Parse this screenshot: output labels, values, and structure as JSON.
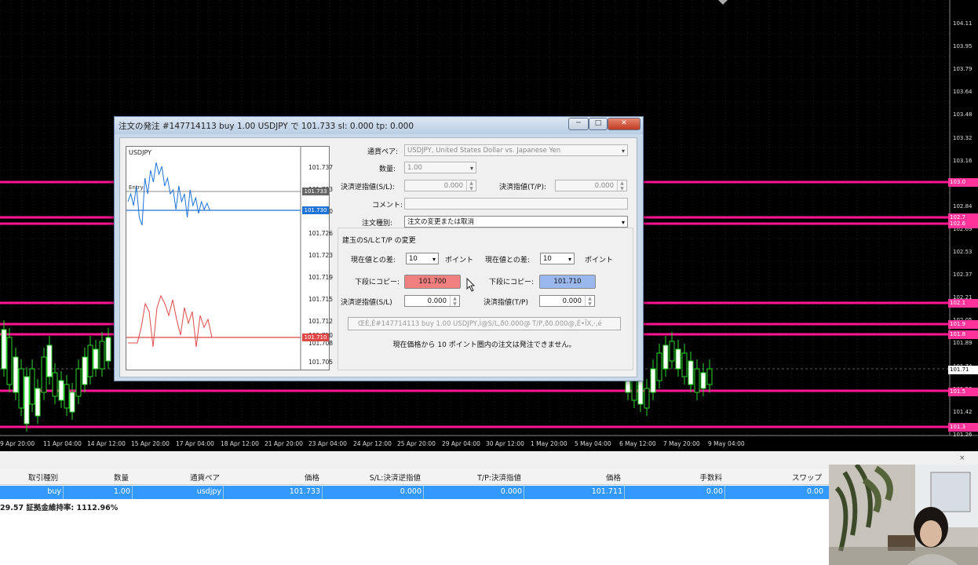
{
  "chart": {
    "price_axis": [
      "104.11",
      "103.95",
      "103.79",
      "103.64",
      "103.48",
      "103.32",
      "103.16",
      "103.00",
      "102.84",
      "102.69",
      "102.53",
      "102.37",
      "102.21",
      "102.05",
      "101.89",
      "101.74",
      "101.58",
      "101.42",
      "101.26"
    ],
    "date_axis": [
      "9 Apr 20:00",
      "11 Apr 04:00",
      "14 Apr 12:00",
      "15 Apr 20:00",
      "17 Apr 04:00",
      "18 Apr 12:00",
      "21 Apr 20:00",
      "23 Apr 04:00",
      "24 Apr 12:00",
      "25 Apr 20:00",
      "29 Apr 04:00",
      "30 Apr 12:00",
      "1 May 20:00",
      "5 May 04:00",
      "6 May 12:00",
      "7 May 20:00",
      "9 May 04:00"
    ],
    "price_tags": [
      {
        "label": "103.0",
        "color": "#ff3399"
      },
      {
        "label": "102.7",
        "color": "#ff3399"
      },
      {
        "label": "102.6",
        "color": "#ff3399"
      },
      {
        "label": "102.1",
        "color": "#ff3399"
      },
      {
        "label": "101.9",
        "color": "#ff3399"
      },
      {
        "label": "101.8",
        "color": "#ff3399"
      },
      {
        "label": "101.71",
        "color": "#ffffff"
      },
      {
        "label": "101.5",
        "color": "#ff3399"
      },
      {
        "label": "101.3",
        "color": "#ff3399"
      }
    ],
    "line_color": "#ff1493"
  },
  "dialog": {
    "title": "注文の発注 #147714113 buy 1.00 USDJPY で 101.733 sl: 0.000 tp: 0.000",
    "mini_chart": {
      "symbol": "USDJPY",
      "entry_label": "Entry",
      "ticks": [
        "101.737",
        "101.733",
        "101.730",
        "101.726",
        "101.723",
        "101.719",
        "101.715",
        "101.712",
        "101.710",
        "101.708",
        "101.705"
      ],
      "ask_tag": "101.733",
      "blue_tag": "101.730",
      "red_tag": "101.710"
    },
    "form": {
      "symbol_label": "通貨ペア:",
      "symbol_value": "USDJPY, United States Dollar vs. Japanese Yen",
      "volume_label": "数量:",
      "volume_value": "1.00",
      "sl_label": "決済逆指値(S/L):",
      "sl_value": "0.000",
      "tp_label": "決済指値(T/P):",
      "tp_value": "0.000",
      "comment_label": "コメント:",
      "comment_value": "",
      "type_label": "注文種別:",
      "type_value": "注文の変更または取消",
      "group_title": "建玉のS/LとT/P の変更",
      "diff_label_left": "現在値との差:",
      "diff_value_left": "10",
      "points_left": "ポイント",
      "diff_label_right": "現在値との差:",
      "diff_value_right": "10",
      "points_right": "ポイント",
      "copy_label_left": "下段にコピー:",
      "copy_value_left": "101.700",
      "copy_label_right": "下段にコピー:",
      "copy_value_right": "101.710",
      "new_sl_label": "決済逆指値(S/L)",
      "new_sl_value": "0.000",
      "new_tp_label": "決済指値(T/P)",
      "new_tp_value": "0.000",
      "info_text": "ŒÈ‚Ê#147714113 buy 1.00 USDJPY‚Ì@S/L‚ð0.000@ T/P‚ð0.000@‚É•ÏX‚·‚é",
      "notice": "現在価格から 10 ポイント圏内の注文は発注できません。"
    },
    "win_buttons": {
      "minimize": "─",
      "maximize": "□",
      "close": "✕"
    }
  },
  "terminal": {
    "headers": [
      "取引種別",
      "数量",
      "通貨ペア",
      "価格",
      "S/L:決済逆指値",
      "T/P:決済指値",
      "価格",
      "手数料",
      "スワップ"
    ],
    "row": [
      "buy",
      "1.00",
      "usdjpy",
      "101.733",
      "0.000",
      "0.000",
      "101.711",
      "0.00",
      "0.00"
    ],
    "summary": "29.57  証拠金維持率: 1112.96%"
  },
  "colors": {
    "sell_copy": "#f08080",
    "buy_copy": "#9ab8ee",
    "selected_row": "#3399ff"
  }
}
